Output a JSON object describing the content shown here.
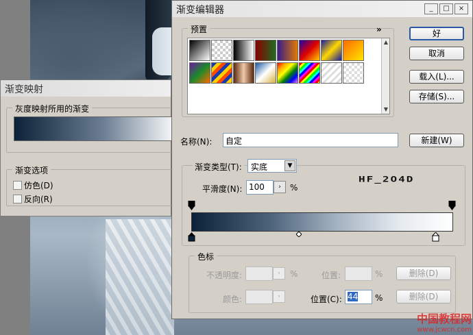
{
  "gradient_map_dialog": {
    "title": "渐变映射",
    "group_label": "灰度映射所用的渐变",
    "options_label": "渐变选项",
    "dither_label": "仿色(D)",
    "reverse_label": "反向(R)"
  },
  "gradient_editor": {
    "title": "渐变编辑器",
    "window_buttons": [
      "_",
      "□",
      "×"
    ],
    "presets_label": "预置",
    "presets_menu": "»",
    "buttons": {
      "ok": "好",
      "cancel": "取消",
      "load": "载入(L)...",
      "save": "存储(S)...",
      "new": "新建(W)"
    },
    "name_label": "名称(N):",
    "name_value": "自定",
    "gradient_type_label": "渐变类型(T):",
    "gradient_type_value": "实底",
    "smoothness_label": "平滑度(N):",
    "smoothness_value": "100",
    "percent": "%",
    "overlay_text": "HF_2O4D",
    "stops_group_label": "色标",
    "opacity_label": "不透明度:",
    "color_label": "颜色:",
    "location_label_top": "位置:",
    "location_label": "位置(C):",
    "location_value": "44",
    "delete_label": "删除(D)",
    "stepper_arrow": "›",
    "dropdown_arrow": "▼"
  },
  "watermark": {
    "site_name": "中国教程网",
    "url": "www.jcwcn.com"
  },
  "colors": {
    "gradient_start": "#0c2239",
    "gradient_end": "#ffffff",
    "dialog_bg": "#d4d0c8",
    "default_button_border": "#2a56a6"
  }
}
